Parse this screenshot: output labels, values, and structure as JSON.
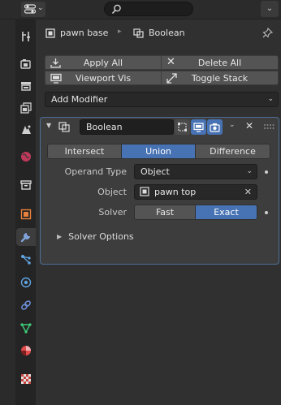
{
  "header": {
    "editor_type_icon": "properties-editor-icon",
    "search_placeholder": ""
  },
  "tabs": [
    {
      "name": "tool-tab-icon",
      "color": "#cfcfcf"
    },
    {
      "name": "render-tab-icon",
      "color": "#cfcfcf"
    },
    {
      "name": "output-tab-icon",
      "color": "#cfcfcf"
    },
    {
      "name": "view-layer-tab-icon",
      "color": "#cfcfcf"
    },
    {
      "name": "scene-tab-icon",
      "color": "#cfcfcf"
    },
    {
      "name": "world-tab-icon",
      "color": "#c0395a"
    },
    {
      "name": "collection-tab-icon",
      "color": "#e0e0e0"
    },
    {
      "name": "object-tab-icon",
      "color": "#e8813c"
    },
    {
      "name": "modifier-tab-icon",
      "color": "#7fa2d8"
    },
    {
      "name": "particles-tab-icon",
      "color": "#5fa4e0"
    },
    {
      "name": "physics-tab-icon",
      "color": "#5fa4e0"
    },
    {
      "name": "constraints-tab-icon",
      "color": "#6e8ed8"
    },
    {
      "name": "data-tab-icon",
      "color": "#3fd07a"
    },
    {
      "name": "material-tab-icon",
      "color": "#e14b4b"
    },
    {
      "name": "texture-tab-icon",
      "color": "#c8453f"
    }
  ],
  "breadcrumb": {
    "object_name": "pawn base",
    "modifier_name": "Boolean"
  },
  "actions": {
    "apply_all": "Apply All",
    "delete_all": "Delete All",
    "viewport_vis": "Viewport Vis",
    "toggle_stack": "Toggle Stack"
  },
  "add_modifier": "Add Modifier",
  "modifier": {
    "name": "Boolean",
    "operations": [
      "Intersect",
      "Union",
      "Difference"
    ],
    "active_operation": "Union",
    "operand_type_label": "Operand Type",
    "operand_type_value": "Object",
    "object_label": "Object",
    "object_value": "pawn top",
    "solver_label": "Solver",
    "solver_options": [
      "Fast",
      "Exact"
    ],
    "active_solver": "Exact",
    "solver_options_panel": "Solver Options"
  },
  "colors": {
    "accent": "#4772b3",
    "panel_border": "#4e6f9a",
    "background": "#303030"
  }
}
